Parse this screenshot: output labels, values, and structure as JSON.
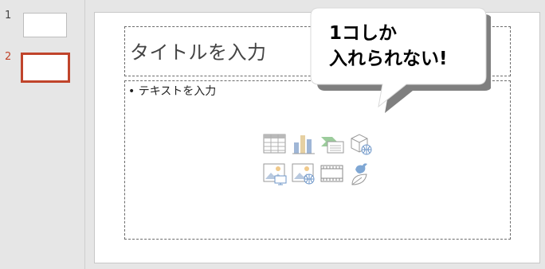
{
  "thumbnails": [
    {
      "number": "1",
      "selected": false
    },
    {
      "number": "2",
      "selected": true
    }
  ],
  "colors": {
    "selected_thumb": "#c0442b",
    "selected_num": "#c0442b"
  },
  "slide": {
    "title_placeholder": "タイトルを入力",
    "body_bullet": "• テキストを入力"
  },
  "content_icons": [
    "insert-table-icon",
    "insert-chart-icon",
    "insert-smartart-icon",
    "insert-3d-model-icon",
    "insert-picture-icon",
    "insert-online-picture-icon",
    "insert-video-icon",
    "insert-icon-icon"
  ],
  "callout": {
    "line1": "1コしか",
    "line2": "入れられない!"
  }
}
